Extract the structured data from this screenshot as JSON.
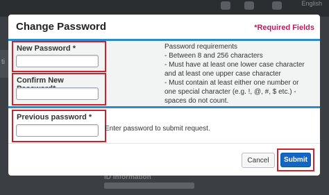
{
  "background": {
    "language": "English",
    "side_fragment": "ti",
    "section_title": "ID Information"
  },
  "dialog": {
    "title": "Change Password",
    "required_note": "*Required Fields"
  },
  "form": {
    "new_password": {
      "label": "New Password *",
      "value": ""
    },
    "confirm_password": {
      "label": "Confirm New Password*",
      "value": ""
    },
    "previous_password": {
      "label": "Previous password *",
      "value": "",
      "hint": "Enter password to submit request."
    }
  },
  "requirements": {
    "heading": "Password requirements",
    "lines": [
      "- Between 8 and 256 characters",
      "- Must have at least one lower case character",
      "and at least one upper case character",
      "- Must contain at least either one number or",
      "one special character (e.g. !, @, #, $ etc.) -",
      "spaces do not count."
    ]
  },
  "buttons": {
    "cancel": "Cancel",
    "submit": "Submit"
  },
  "colors": {
    "accent": "#2a8ccf",
    "required": "#c2185b",
    "highlight": "#d0202a",
    "submit": "#1466c4"
  }
}
